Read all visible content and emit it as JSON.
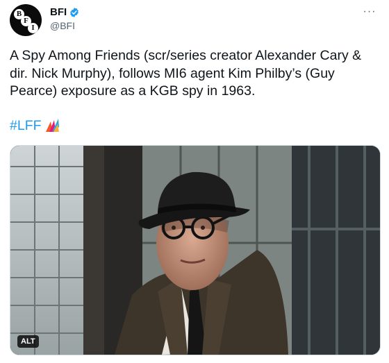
{
  "author": {
    "name": "BFI",
    "handle": "@BFI",
    "verified_icon": "verified-badge-icon",
    "avatar_letters": [
      "B",
      "F",
      "I"
    ]
  },
  "menu_icon": "more-horizontal-icon",
  "menu_glyph": "···",
  "tweet": {
    "text": "A Spy Among Friends (scr/series creator Alexander Cary & dir. Nick Murphy), follows MI6 agent Kim Philby’s (Guy Pearce) exposure as a KGB spy in 1963.",
    "hashtag": "#LFF",
    "hashtag_icon": "lff-logo-icon"
  },
  "media": {
    "alt_badge": "ALT"
  },
  "colors": {
    "link": "#1d9bf0",
    "text": "#0f1419",
    "secondary": "#536471",
    "verified": "#1d9bf0"
  }
}
